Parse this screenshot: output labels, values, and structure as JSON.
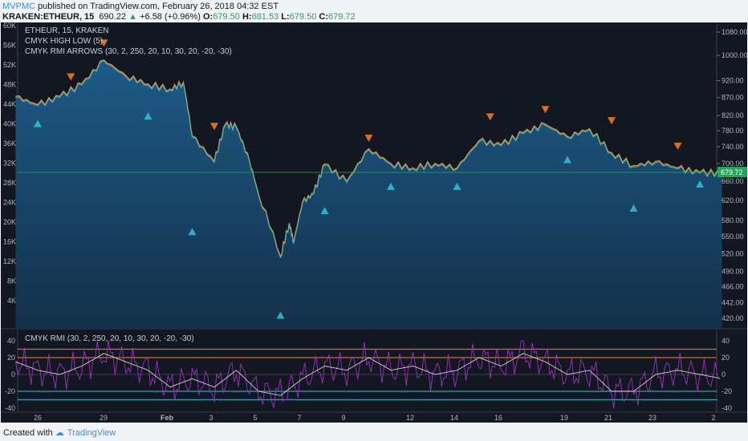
{
  "header": {
    "publisher": "MVPMC",
    "published_text": "published on TradingView.com, February 26, 2018 04:32 EST",
    "symbol": "KRAKEN:ETHEUR, 15",
    "last": "690.22",
    "change": "+6.58 (+0.96%)",
    "o_label": "O:",
    "o": "679.50",
    "h_label": "H:",
    "h": "681.53",
    "l_label": "L:",
    "l": "679.50",
    "c_label": "C:",
    "c": "679.72"
  },
  "legend": {
    "series": "ETHEUR, 15, KRAKEN",
    "ind1": "CMYK HIGH LOW (5)",
    "ind2": "CMYK RMI ARROWS (30, 2, 250, 20, 10, 30, 20, -20, -30)",
    "rmi": "CMYK RMI (30, 2, 250, 20, 10, 30, 20, -20, -30)"
  },
  "footer": {
    "created_with": "Created with",
    "brand": "TradingView"
  },
  "colors": {
    "background": "#131722",
    "area": "#1c4a6e",
    "up_arrow": "#2ec4dc",
    "down_arrow": "#ff7f1e",
    "price_label": "#26a65b",
    "rmi": "#a12fc0",
    "signal": "#d0d0d0"
  },
  "chart_data": [
    {
      "type": "area",
      "title": "ETHEUR, 15, KRAKEN",
      "y_scale": "log",
      "ylim": [
        410,
        1110
      ],
      "y_ticks_right": [
        "1080.00",
        "1000.00",
        "920.00",
        "870.00",
        "820.00",
        "780.00",
        "740.00",
        "700.00",
        "660.00",
        "620.00",
        "580.00",
        "550.00",
        "520.00",
        "490.00",
        "466.00",
        "442.00",
        "420.00"
      ],
      "y_ticks_left": [
        "60K",
        "56K",
        "52K",
        "48K",
        "44K",
        "40K",
        "36K",
        "32K",
        "28K",
        "24K",
        "20K",
        "16K",
        "12K",
        "8K",
        "4K"
      ],
      "x_ticks": [
        "26",
        "29",
        "Feb",
        "3",
        "5",
        "7",
        "9",
        "12",
        "14",
        "16",
        "19",
        "21",
        "23",
        "2"
      ],
      "last_price_label": "679.72",
      "series": [
        {
          "x": [
            "Jan 25",
            "Jan 26",
            "Jan 27",
            "Jan 28",
            "Jan 29",
            "Jan 30",
            "Jan 31",
            "Feb 1",
            "Feb 1.6",
            "Feb 2",
            "Feb 3",
            "Feb 3.5",
            "Feb 4",
            "Feb 4.6",
            "Feb 5",
            "Feb 6",
            "Feb 6.4",
            "Feb 6.6",
            "Feb 7",
            "Feb 7.5",
            "Feb 8",
            "Feb 9",
            "Feb 10",
            "Feb 11",
            "Feb 12",
            "Feb 13",
            "Feb 14",
            "Feb 15",
            "Feb 16",
            "Feb 17",
            "Feb 18",
            "Feb 19",
            "Feb 20",
            "Feb 21",
            "Feb 22",
            "Feb 23",
            "Feb 24",
            "Feb 25",
            "Feb 26"
          ],
          "values": [
            874,
            850,
            874,
            910,
            985,
            935,
            910,
            895,
            915,
            767,
            705,
            797,
            790,
            705,
            633,
            515,
            575,
            540,
            617,
            635,
            699,
            660,
            735,
            700,
            690,
            700,
            690,
            755,
            745,
            775,
            797,
            765,
            785,
            725,
            695,
            705,
            690,
            680,
            679.72
          ]
        }
      ],
      "markers": [
        {
          "x": "Jan 29",
          "price": 1040,
          "type": "down"
        },
        {
          "x": "Jan 27.5",
          "price": 930,
          "type": "down"
        },
        {
          "x": "Feb 3",
          "price": 790,
          "type": "down"
        },
        {
          "x": "Feb 10",
          "price": 760,
          "type": "down"
        },
        {
          "x": "Feb 15.5",
          "price": 815,
          "type": "down"
        },
        {
          "x": "Feb 18",
          "price": 835,
          "type": "down"
        },
        {
          "x": "Feb 21",
          "price": 805,
          "type": "down"
        },
        {
          "x": "Feb 24",
          "price": 740,
          "type": "down"
        },
        {
          "x": "Jan 26",
          "price": 800,
          "type": "up"
        },
        {
          "x": "Jan 31",
          "price": 820,
          "type": "up"
        },
        {
          "x": "Feb 2",
          "price": 560,
          "type": "up"
        },
        {
          "x": "Feb 6",
          "price": 425,
          "type": "up"
        },
        {
          "x": "Feb 8",
          "price": 600,
          "type": "up"
        },
        {
          "x": "Feb 11",
          "price": 650,
          "type": "up"
        },
        {
          "x": "Feb 14",
          "price": 650,
          "type": "up"
        },
        {
          "x": "Feb 19",
          "price": 710,
          "type": "up"
        },
        {
          "x": "Feb 22",
          "price": 605,
          "type": "up"
        },
        {
          "x": "Feb 25",
          "price": 655,
          "type": "up"
        }
      ]
    },
    {
      "type": "line",
      "title": "CMYK RMI (30, 2, 250, 20, 10, 30, 20, -20, -30)",
      "ylim": [
        -45,
        45
      ],
      "y_ticks": [
        "40",
        "20",
        "0",
        "-20",
        "-40"
      ],
      "levels": [
        30,
        20,
        0,
        -20,
        -30
      ],
      "x": [
        "Jan 25",
        "Jan 26",
        "Jan 27",
        "Jan 28",
        "Jan 29",
        "Jan 30",
        "Jan 31",
        "Feb 1",
        "Feb 2",
        "Feb 3",
        "Feb 4",
        "Feb 5",
        "Feb 6",
        "Feb 7",
        "Feb 8",
        "Feb 9",
        "Feb 10",
        "Feb 11",
        "Feb 12",
        "Feb 13",
        "Feb 14",
        "Feb 15",
        "Feb 16",
        "Feb 17",
        "Feb 18",
        "Feb 19",
        "Feb 20",
        "Feb 21",
        "Feb 22",
        "Feb 23",
        "Feb 24",
        "Feb 25",
        "Feb 26"
      ],
      "signal": [
        15,
        5,
        0,
        10,
        25,
        15,
        5,
        -15,
        -5,
        -15,
        5,
        -20,
        -25,
        -5,
        10,
        5,
        20,
        5,
        10,
        0,
        5,
        20,
        10,
        25,
        15,
        0,
        5,
        -20,
        -20,
        0,
        5,
        0,
        -5
      ]
    }
  ]
}
